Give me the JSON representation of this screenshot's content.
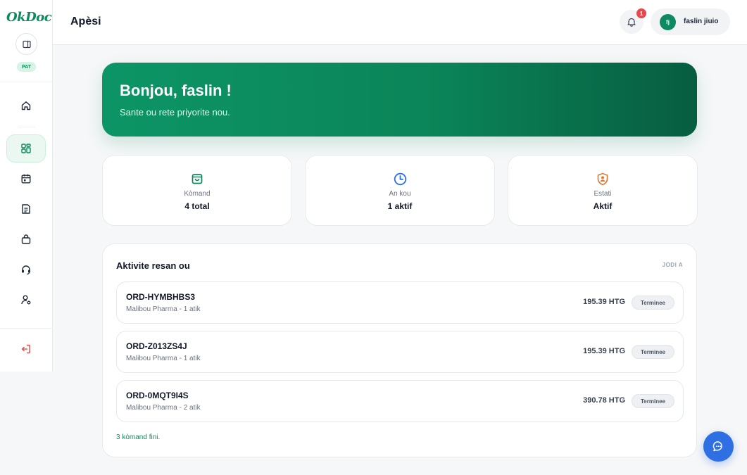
{
  "app": {
    "logo_text": "OkDoc",
    "role_badge": "PAT"
  },
  "header": {
    "title": "Apèsi",
    "notification_count": "1",
    "user_initials": "fj",
    "user_name": "faslin jiuio"
  },
  "hero": {
    "greeting": "Bonjou, faslin !",
    "subtitle": "Sante ou rete priyorite nou."
  },
  "stats": [
    {
      "label": "Kòmand",
      "value": "4 total",
      "icon": "shopping-bag-icon",
      "color": "#0d8a5f"
    },
    {
      "label": "An kou",
      "value": "1 aktif",
      "icon": "clock-icon",
      "color": "#2f6fe4"
    },
    {
      "label": "Estati",
      "value": "Aktif",
      "icon": "user-badge-icon",
      "color": "#e07a2f"
    }
  ],
  "activity": {
    "title": "Aktivite resan ou",
    "today_label": "JODI A",
    "orders": [
      {
        "id": "ORD-HYMBHBS3",
        "meta": "Malibou Pharma - 1 atik",
        "amount": "195.39 HTG",
        "status": "Terminee"
      },
      {
        "id": "ORD-Z013ZS4J",
        "meta": "Malibou Pharma - 1 atik",
        "amount": "195.39 HTG",
        "status": "Terminee"
      },
      {
        "id": "ORD-0MQT9I4S",
        "meta": "Malibou Pharma - 2 atik",
        "amount": "390.78 HTG",
        "status": "Terminee"
      }
    ],
    "footer": "3 kòmand fini."
  },
  "sidebar": {
    "items": [
      {
        "icon": "home-icon"
      },
      {
        "icon": "dashboard-icon",
        "active": true
      },
      {
        "icon": "calendar-icon"
      },
      {
        "icon": "document-icon"
      },
      {
        "icon": "shopping-bag-icon"
      },
      {
        "icon": "support-headset-icon"
      },
      {
        "icon": "user-settings-icon"
      },
      {
        "icon": "logout-icon"
      }
    ]
  },
  "colors": {
    "brand": "#0d8a5f",
    "accent_blue": "#2f6fe4",
    "accent_orange": "#e07a2f",
    "danger": "#e5484d"
  }
}
